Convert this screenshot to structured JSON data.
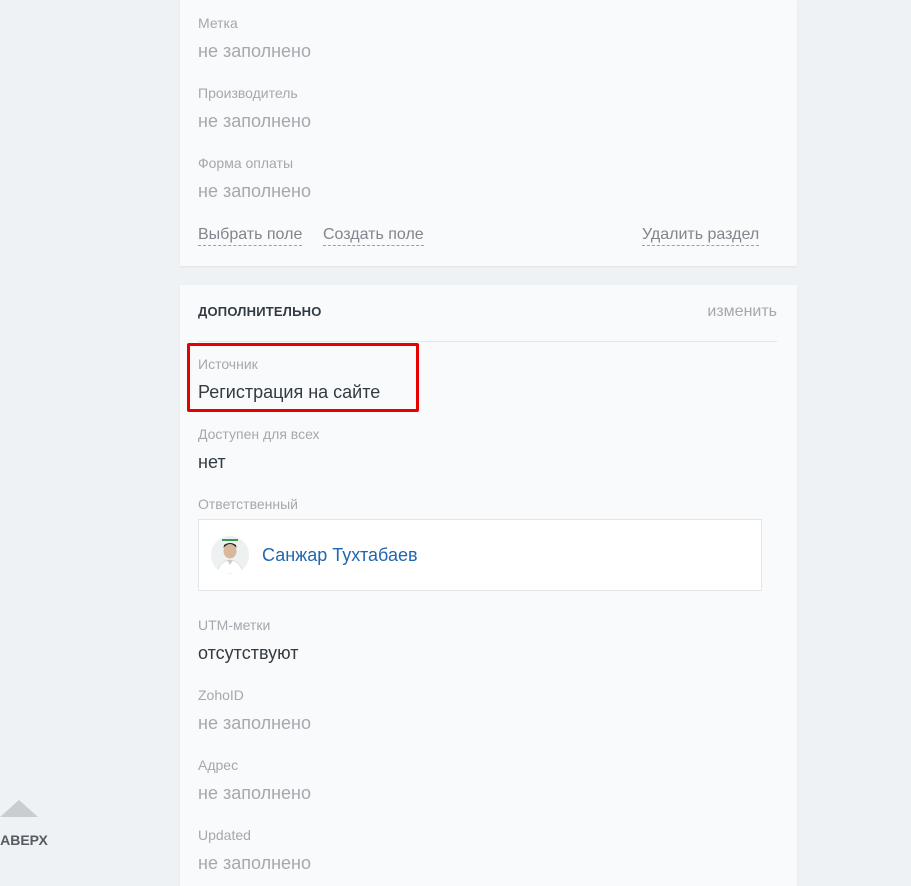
{
  "top_section": {
    "fields": [
      {
        "label": "Метка",
        "value": "не заполнено"
      },
      {
        "label": "Производитель",
        "value": "не заполнено"
      },
      {
        "label": "Форма оплаты",
        "value": "не заполнено"
      }
    ],
    "select_field_label": "Выбрать поле",
    "create_field_label": "Создать поле",
    "delete_section_label": "Удалить раздел"
  },
  "additional_section": {
    "title": "ДОПОЛНИТЕЛЬНО",
    "edit_label": "изменить",
    "source": {
      "label": "Источник",
      "value": "Регистрация на сайте"
    },
    "available_for_all": {
      "label": "Доступен для всех",
      "value": "нет"
    },
    "responsible": {
      "label": "Ответственный",
      "name": "Санжар Тухтабаев"
    },
    "utm": {
      "label": "UTM-метки",
      "value": "отсутствуют"
    },
    "zohoid": {
      "label": "ZohoID",
      "value": "не заполнено"
    },
    "address": {
      "label": "Адрес",
      "value": "не заполнено"
    },
    "updated": {
      "label": "Updated",
      "value": "не заполнено"
    }
  },
  "scroll_up": {
    "label": "НАВЕРХ"
  },
  "colors": {
    "highlight": "#e60000",
    "link": "#2067b0"
  }
}
